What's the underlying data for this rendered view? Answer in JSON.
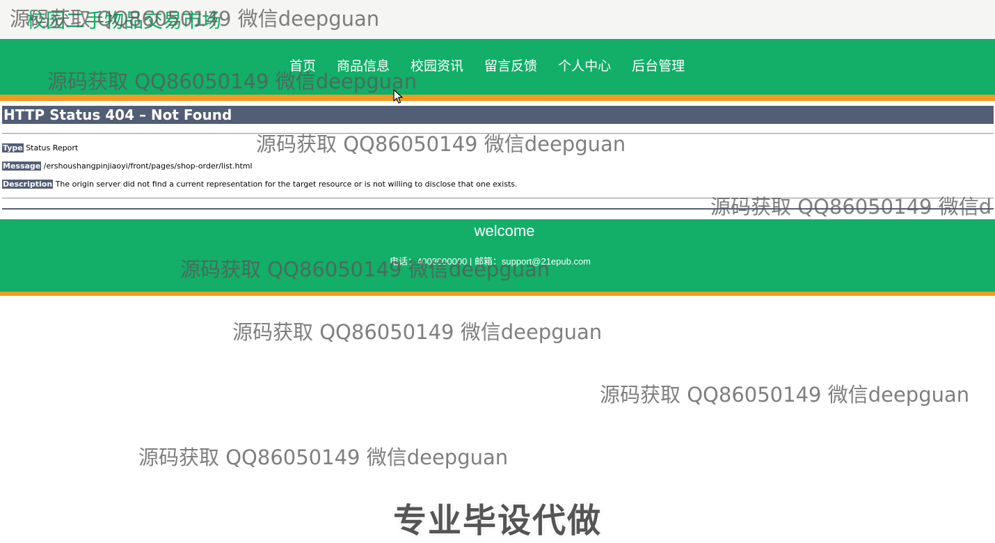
{
  "header": {
    "site_title": "校园二手物品交易市场"
  },
  "nav": {
    "items": [
      {
        "label": "首页"
      },
      {
        "label": "商品信息"
      },
      {
        "label": "校园资讯"
      },
      {
        "label": "留言反馈"
      },
      {
        "label": "个人中心"
      },
      {
        "label": "后台管理"
      }
    ]
  },
  "error": {
    "title": "HTTP Status 404 – Not Found",
    "type_label": "Type",
    "type_value": "Status Report",
    "message_label": "Message",
    "message_value": "/ershoushangpinjiaoyi/front/pages/shop-order/list.html",
    "description_label": "Description",
    "description_value": "The origin server did not find a current representation for the target resource or is not willing to disclose that one exists."
  },
  "footer": {
    "welcome": "welcome",
    "contact": "电话：4008000000 | 邮箱：support@21epub.com"
  },
  "watermark": {
    "text": "源码获取 QQ86050149 微信deepguan",
    "text_cut": "源码获取 QQ86050149 微信d",
    "promo": "专业毕设代做"
  },
  "colors": {
    "primary_green": "#13ae68",
    "accent_orange": "#f39a1f",
    "tomcat_slate": "#525d76",
    "title_green": "#15a865"
  }
}
